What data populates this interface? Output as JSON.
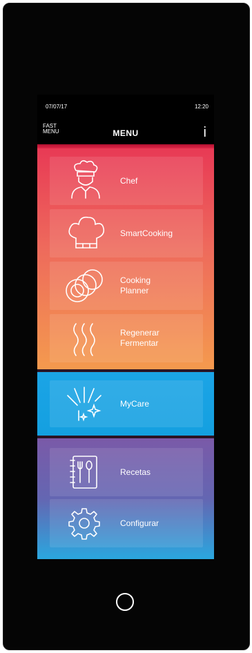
{
  "status": {
    "date": "07/07/17",
    "time": "12:20"
  },
  "header": {
    "fast_menu": [
      "FAST",
      "MENU"
    ],
    "title": "MENU",
    "info": "i"
  },
  "tiles": [
    {
      "id": "chef",
      "label": [
        "Chef"
      ],
      "icon": "chef-icon"
    },
    {
      "id": "smartcooking",
      "label": [
        "SmartCooking"
      ],
      "icon": "chef-hat-icon"
    },
    {
      "id": "cooking-planner",
      "label": [
        "Cooking",
        "Planner"
      ],
      "icon": "plates-icon"
    },
    {
      "id": "regenerar",
      "label": [
        "Regenerar",
        "Fermentar"
      ],
      "icon": "steam-icon"
    },
    {
      "id": "mycare",
      "label": [
        "MyCare"
      ],
      "icon": "sparkle-clean-icon"
    },
    {
      "id": "recetas",
      "label": [
        "Recetas"
      ],
      "icon": "recipe-book-icon"
    },
    {
      "id": "configurar",
      "label": [
        "Configurar"
      ],
      "icon": "gear-icon"
    }
  ],
  "colors": {
    "warm_top": "#e83a55",
    "warm_bottom": "#f49a4e",
    "care": "#1ba4e6",
    "cool_top": "#7a5aa8",
    "cool_bottom": "#2aa7df"
  }
}
